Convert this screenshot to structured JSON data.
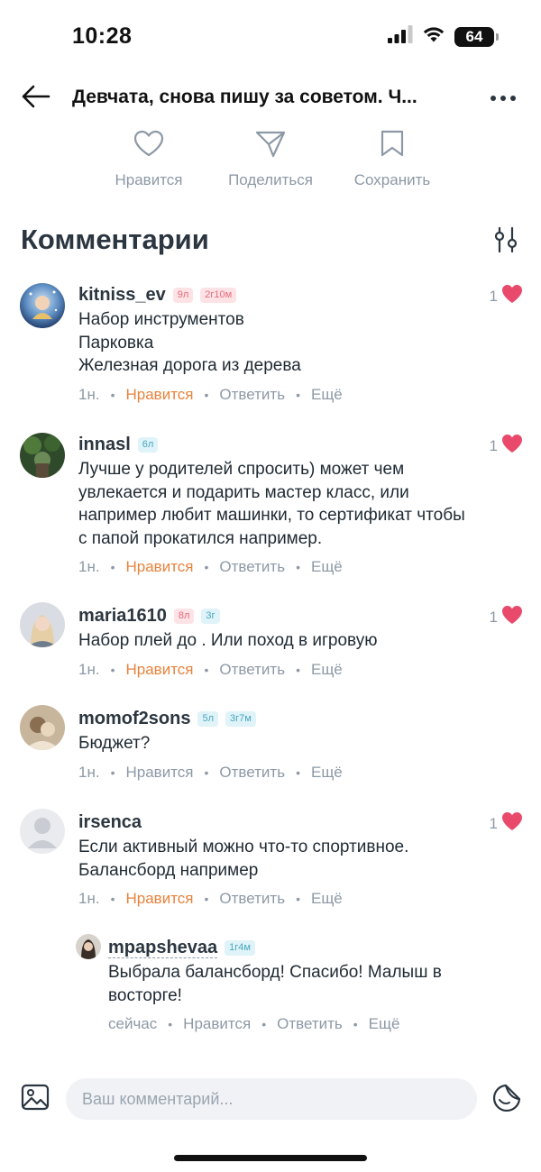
{
  "status_bar": {
    "time": "10:28",
    "battery": "64"
  },
  "header": {
    "title": "Девчата, снова пишу за советом. Ч..."
  },
  "actions": {
    "like_label": "Нравится",
    "share_label": "Поделиться",
    "save_label": "Сохранить"
  },
  "comments_title": "Комментарии",
  "colors": {
    "accent_orange": "#e8833d",
    "heart_pink": "#e94a6c",
    "muted": "#8d99a6"
  },
  "comments": [
    {
      "username": "kitniss_ev",
      "tags": [
        "9л",
        "2г10м"
      ],
      "lines": [
        "Набор инструментов",
        "Парковка",
        "Железная дорога из дерева"
      ],
      "meta": {
        "time": "1н.",
        "like": "Нравится",
        "reply": "Ответить",
        "more": "Ещё"
      },
      "likes": "1"
    },
    {
      "username": "innasl",
      "tags": [
        "6л"
      ],
      "lines": [
        "Лучше у родителей спросить) может чем",
        "увлекается и подарить мастер класс, или",
        "например любит машинки, то сертификат чтобы",
        "с папой прокатился например."
      ],
      "meta": {
        "time": "1н.",
        "like": "Нравится",
        "reply": "Ответить",
        "more": "Ещё"
      },
      "likes": "1"
    },
    {
      "username": "maria1610",
      "tags": [
        "8л",
        "3г"
      ],
      "lines": [
        "Набор плей до . Или поход в игровую"
      ],
      "meta": {
        "time": "1н.",
        "like": "Нравится",
        "reply": "Ответить",
        "more": "Ещё"
      },
      "likes": "1"
    },
    {
      "username": "momof2sons",
      "tags": [
        "5л",
        "3г7м"
      ],
      "lines": [
        "Бюджет?"
      ],
      "meta": {
        "time": "1н.",
        "like": "Нравится",
        "reply": "Ответить",
        "more": "Ещё"
      }
    },
    {
      "username": "irsenca",
      "tags": [],
      "lines": [
        "Если активный можно что-то спортивное.",
        "Балансборд например"
      ],
      "meta": {
        "time": "1н.",
        "like": "Нравится",
        "reply": "Ответить",
        "more": "Ещё"
      },
      "likes": "1",
      "reply": {
        "username": "mpapshevaa",
        "tags": [
          "1г4м"
        ],
        "lines": [
          "Выбрала балансборд! Спасибо! Малыш в",
          "восторге!"
        ],
        "meta": {
          "time": "сейчас",
          "like": "Нравится",
          "reply": "Ответить",
          "more": "Ещё"
        }
      }
    }
  ],
  "composer": {
    "placeholder": "Ваш комментарий..."
  }
}
